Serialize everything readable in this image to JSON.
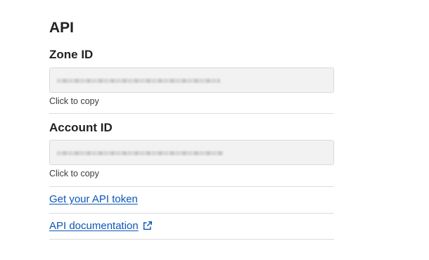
{
  "api": {
    "title": "API",
    "zone": {
      "label": "Zone ID",
      "helper": "Click to copy"
    },
    "account": {
      "label": "Account ID",
      "helper": "Click to copy"
    },
    "links": {
      "token": "Get your API token",
      "docs": "API documentation"
    }
  },
  "icons": {
    "external": "external-link-icon"
  },
  "colors": {
    "link": "#0a56b8",
    "box_bg": "#f2f2f2"
  }
}
